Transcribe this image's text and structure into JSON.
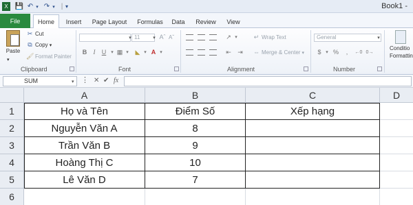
{
  "window": {
    "title": "Book1 -"
  },
  "qat": {
    "save_icon": "save-icon",
    "undo_icon": "undo-icon",
    "redo_icon": "redo-icon"
  },
  "tabs": [
    {
      "label": "File"
    },
    {
      "label": "Home"
    },
    {
      "label": "Insert"
    },
    {
      "label": "Page Layout"
    },
    {
      "label": "Formulas"
    },
    {
      "label": "Data"
    },
    {
      "label": "Review"
    },
    {
      "label": "View"
    }
  ],
  "ribbon": {
    "clipboard": {
      "paste": "Paste",
      "cut": "Cut",
      "copy": "Copy",
      "format_painter": "Format Painter",
      "label": "Clipboard"
    },
    "font": {
      "font_size": "11",
      "label": "Font"
    },
    "alignment": {
      "wrap_text": "Wrap Text",
      "merge_center": "Merge & Center",
      "label": "Alignment"
    },
    "number": {
      "format": "General",
      "label": "Number"
    },
    "styles": {
      "conditional_1": "Conditio",
      "conditional_2": "Formattin"
    }
  },
  "formula_bar": {
    "name_box": "SUM",
    "cancel": "✕",
    "enter": "✔",
    "fx": "fx"
  },
  "sheet": {
    "columns": [
      "A",
      "B",
      "C",
      "D"
    ],
    "rows": [
      "1",
      "2",
      "3",
      "4",
      "5",
      "6"
    ],
    "cells": [
      [
        "Họ và Tên",
        "Điểm Số",
        "Xếp hạng"
      ],
      [
        "Nguyễn Văn A",
        "8",
        ""
      ],
      [
        "Trần Văn B",
        "9",
        ""
      ],
      [
        "Hoàng Thị C",
        "10",
        ""
      ],
      [
        "Lê Văn D",
        "7",
        ""
      ],
      [
        "",
        "",
        ""
      ]
    ]
  }
}
